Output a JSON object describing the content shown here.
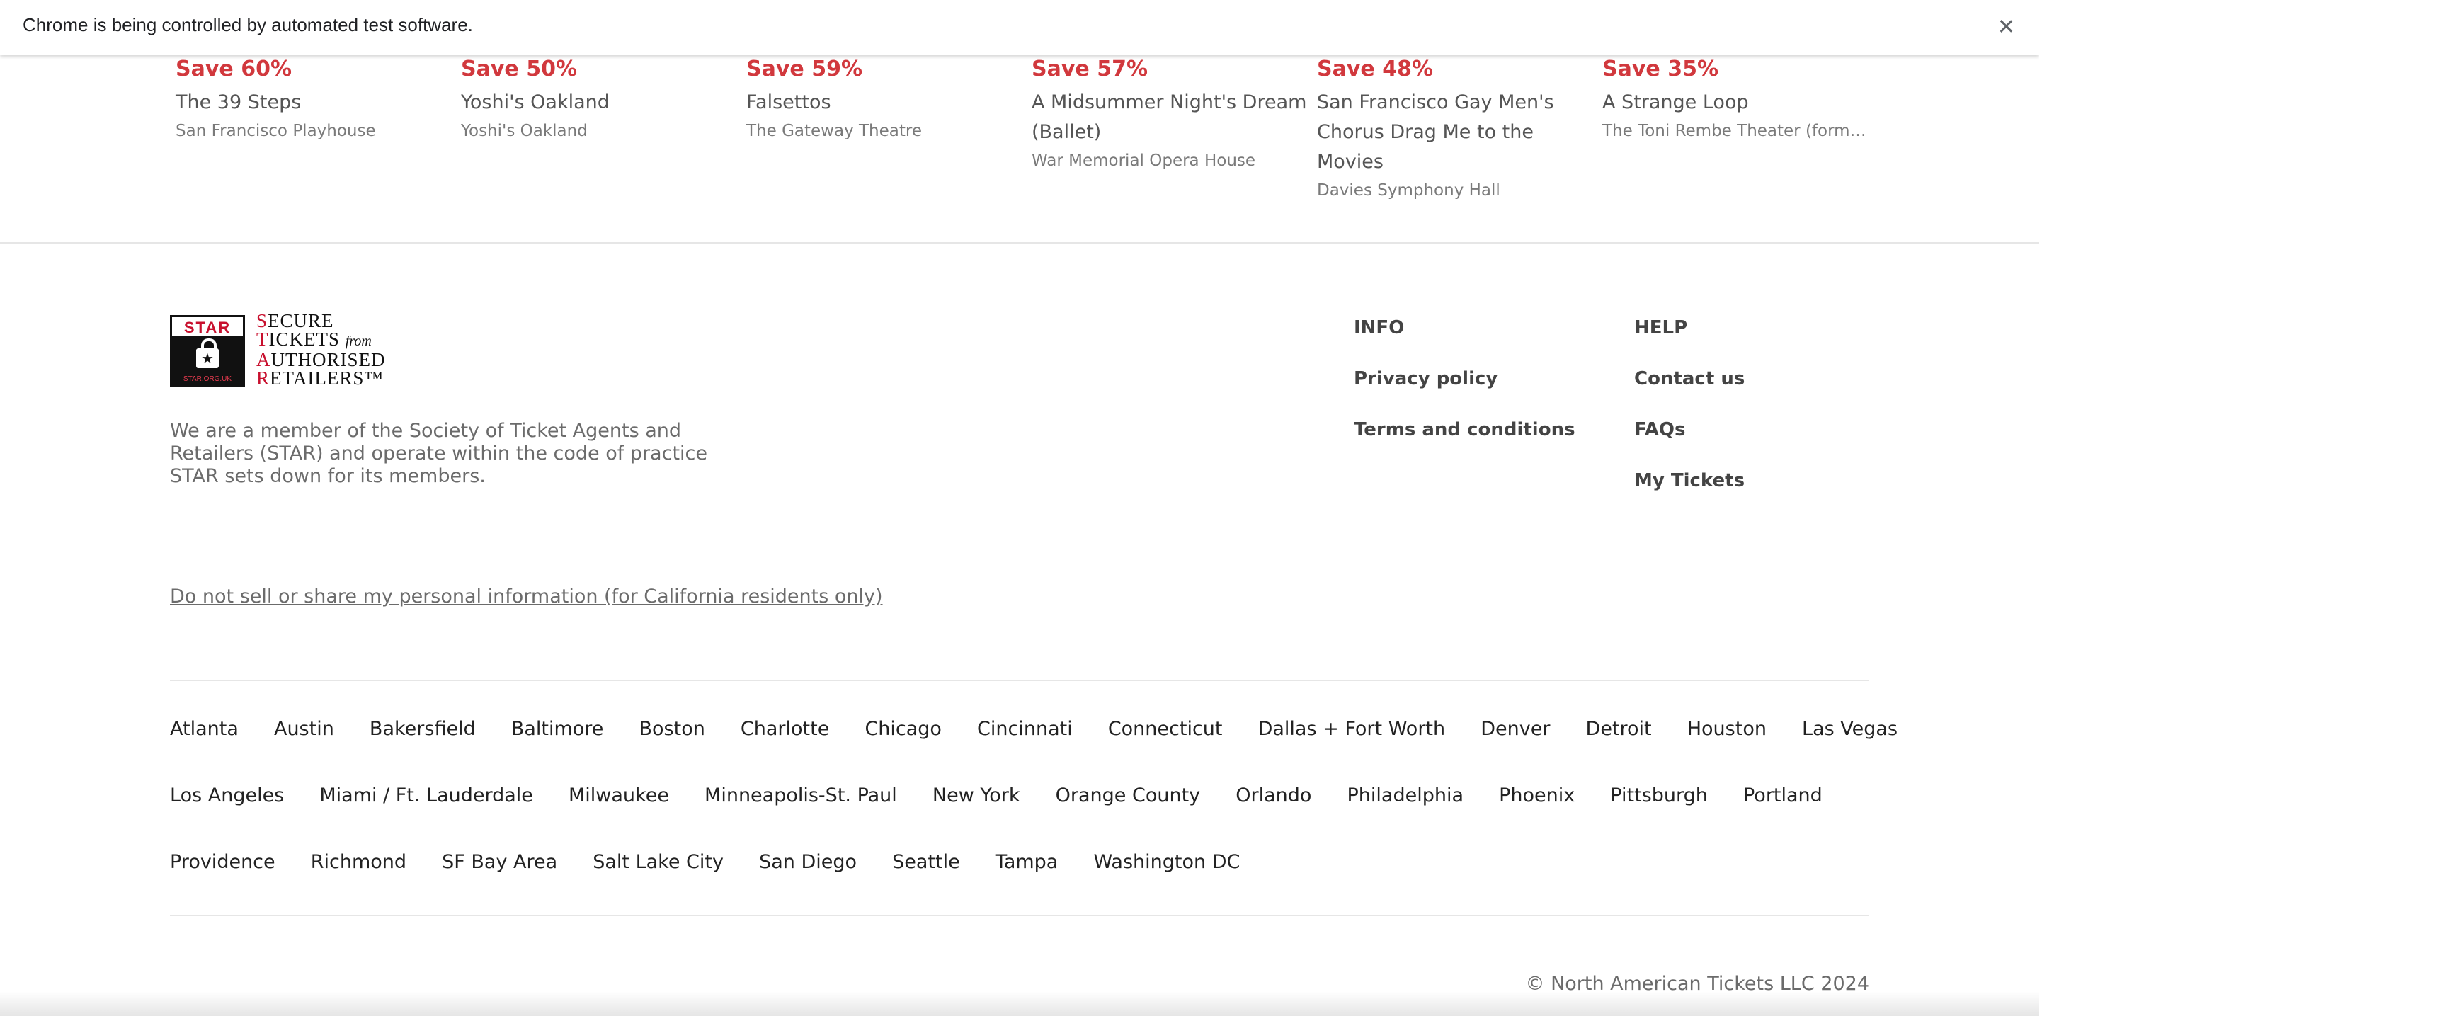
{
  "infobar": {
    "message": "Chrome is being controlled by automated test software.",
    "close_icon": "close-icon"
  },
  "deals": [
    {
      "save": "Save 60%",
      "name": "The 39 Steps",
      "venue": "San Francisco Playhouse"
    },
    {
      "save": "Save 50%",
      "name": "Yoshi's Oakland",
      "venue": "Yoshi's Oakland"
    },
    {
      "save": "Save 59%",
      "name": "Falsettos",
      "venue": "The Gateway Theatre"
    },
    {
      "save": "Save 57%",
      "name": "A Midsummer Night's Dream (Ballet)",
      "venue": "War Memorial Opera House"
    },
    {
      "save": "Save 48%",
      "name": "San Francisco Gay Men's Chorus Drag Me to the Movies",
      "venue": "Davies Symphony Hall"
    },
    {
      "save": "Save 35%",
      "name": "A Strange Loop",
      "venue": "The Toni Rembe Theater (former..."
    }
  ],
  "star": {
    "box_label": "STAR",
    "box_footer": "STAR.ORG.UK",
    "lines": [
      {
        "cap": "S",
        "rest": "ECURE"
      },
      {
        "cap": "T",
        "rest": "ICKETS",
        "from": "from"
      },
      {
        "cap": "A",
        "rest": "UTHORISED"
      },
      {
        "cap": "R",
        "rest": "ETAILERS™"
      }
    ],
    "description": "We are a member of the Society of Ticket Agents and Retailers (STAR) and operate within the code of practice STAR sets down for its members."
  },
  "info": {
    "title": "INFO",
    "links": [
      "Privacy policy",
      "Terms and conditions"
    ]
  },
  "help": {
    "title": "HELP",
    "links": [
      "Contact us",
      "FAQs",
      "My Tickets"
    ]
  },
  "privacy_notice": "Do not sell or share my personal information (for California residents only)",
  "cities": [
    [
      "Atlanta",
      "Austin",
      "Bakersfield",
      "Baltimore",
      "Boston",
      "Charlotte",
      "Chicago",
      "Cincinnati",
      "Connecticut",
      "Dallas + Fort Worth",
      "Denver",
      "Detroit",
      "Houston",
      "Las Vegas"
    ],
    [
      "Los Angeles",
      "Miami / Ft. Lauderdale",
      "Milwaukee",
      "Minneapolis-St. Paul",
      "New York",
      "Orange County",
      "Orlando",
      "Philadelphia",
      "Phoenix",
      "Pittsburgh",
      "Portland"
    ],
    [
      "Providence",
      "Richmond",
      "SF Bay Area",
      "Salt Lake City",
      "San Diego",
      "Seattle",
      "Tampa",
      "Washington DC"
    ]
  ],
  "copyright": "© North American Tickets LLC 2024",
  "colors": {
    "save_red": "#d1383d",
    "star_red": "#c8102e",
    "text_gray": "#6b6b6b"
  }
}
